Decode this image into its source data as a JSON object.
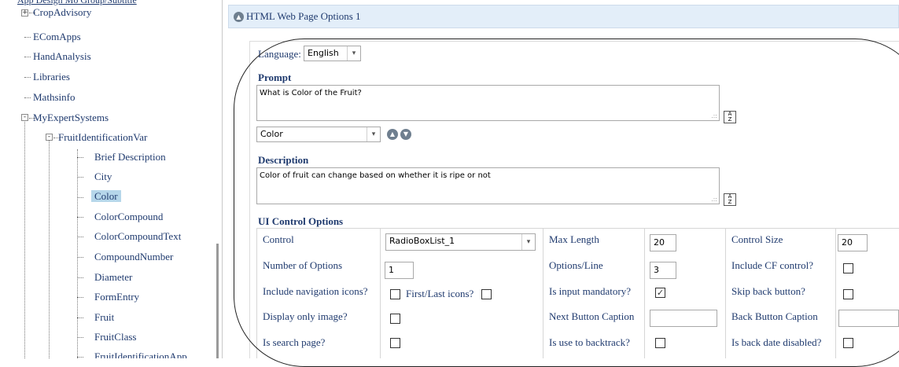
{
  "tree": {
    "top_cut_label": "App Design Mo Group/Subtitle",
    "items": [
      {
        "label": "CropAdvisory",
        "expander": "+"
      },
      {
        "label": "EComApps"
      },
      {
        "label": "HandAnalysis"
      },
      {
        "label": "Libraries"
      },
      {
        "label": "Mathsinfo"
      },
      {
        "label": "MyExpertSystems",
        "expander": "-"
      },
      {
        "label": "FruitIdentificationVar",
        "expander": "-"
      },
      {
        "label": "Brief Description"
      },
      {
        "label": "City"
      },
      {
        "label": "Color",
        "selected": true
      },
      {
        "label": "ColorCompound"
      },
      {
        "label": "ColorCompoundText"
      },
      {
        "label": "CompoundNumber"
      },
      {
        "label": "Diameter"
      },
      {
        "label": "FormEntry"
      },
      {
        "label": "Fruit"
      },
      {
        "label": "FruitClass"
      },
      {
        "label": "FruitIdentificationApp"
      }
    ]
  },
  "panel": {
    "title": "HTML Web Page Options 1",
    "collapse_icon": "chevron-up-circle-icon"
  },
  "language": {
    "label": "Language:",
    "value": "English"
  },
  "prompt": {
    "heading": "Prompt",
    "text": "What is Color of the Fruit?",
    "variable": "Color"
  },
  "description": {
    "heading": "Description",
    "text": "Color of fruit can change based on whether it is ripe or not"
  },
  "ui_options": {
    "heading": "UI Control Options",
    "control_label": "Control",
    "control_value": "RadioBoxList_1",
    "max_length_label": "Max Length",
    "max_length_value": "20",
    "control_size_label": "Control Size",
    "control_size_value": "20",
    "num_options_label": "Number of Options",
    "num_options_value": "1",
    "options_line_label": "Options/Line",
    "options_line_value": "3",
    "include_cf_label": "Include CF control?",
    "include_cf_checked": false,
    "nav_icons_label": "Include navigation icons?",
    "nav_icons_checked": false,
    "first_last_label": "First/Last icons?",
    "first_last_checked": false,
    "mandatory_label": "Is input mandatory?",
    "mandatory_checked": true,
    "skip_back_label": "Skip back button?",
    "skip_back_checked": false,
    "display_image_label": "Display only image?",
    "display_image_checked": false,
    "next_caption_label": "Next Button Caption",
    "next_caption_value": "",
    "back_caption_label": "Back Button Caption",
    "back_caption_value": "",
    "search_page_label": "Is search page?",
    "search_page_checked": false,
    "backtrack_label": "Is use to backtrack?",
    "backtrack_checked": false,
    "back_date_label": "Is back date disabled?",
    "back_date_checked": false
  },
  "glyphs": {
    "caret": "▾",
    "check": "✓",
    "up": "▲",
    "down": "▼",
    "grip": ".::"
  }
}
